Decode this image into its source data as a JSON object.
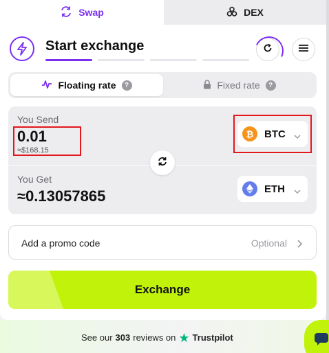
{
  "tabs": {
    "swap_label": "Swap",
    "dex_label": "DEX",
    "active": "Swap"
  },
  "header": {
    "title": "Start exchange",
    "steps_total": 4,
    "step_current": 1
  },
  "rate": {
    "floating_label": "Floating rate",
    "fixed_label": "Fixed rate",
    "selected": "Floating rate"
  },
  "send": {
    "label": "You Send",
    "amount": "0.01",
    "usd": "≈$168.15",
    "coin": "BTC",
    "coin_icon": "bitcoin-icon"
  },
  "get": {
    "label": "You Get",
    "amount": "≈0.13057865",
    "coin": "ETH",
    "coin_icon": "ethereum-icon"
  },
  "promo": {
    "label": "Add a promo code",
    "optional": "Optional"
  },
  "exchange_button": "Exchange",
  "footer": {
    "see_our": "See our",
    "count": "303",
    "reviews_on": "reviews on",
    "brand": "Trustpilot"
  },
  "colors": {
    "accent": "#7b2ff2",
    "button": "#c0f20a",
    "highlight": "#e3161b",
    "btc": "#f7931a",
    "eth": "#627eea",
    "trustpilot": "#00b67a"
  }
}
